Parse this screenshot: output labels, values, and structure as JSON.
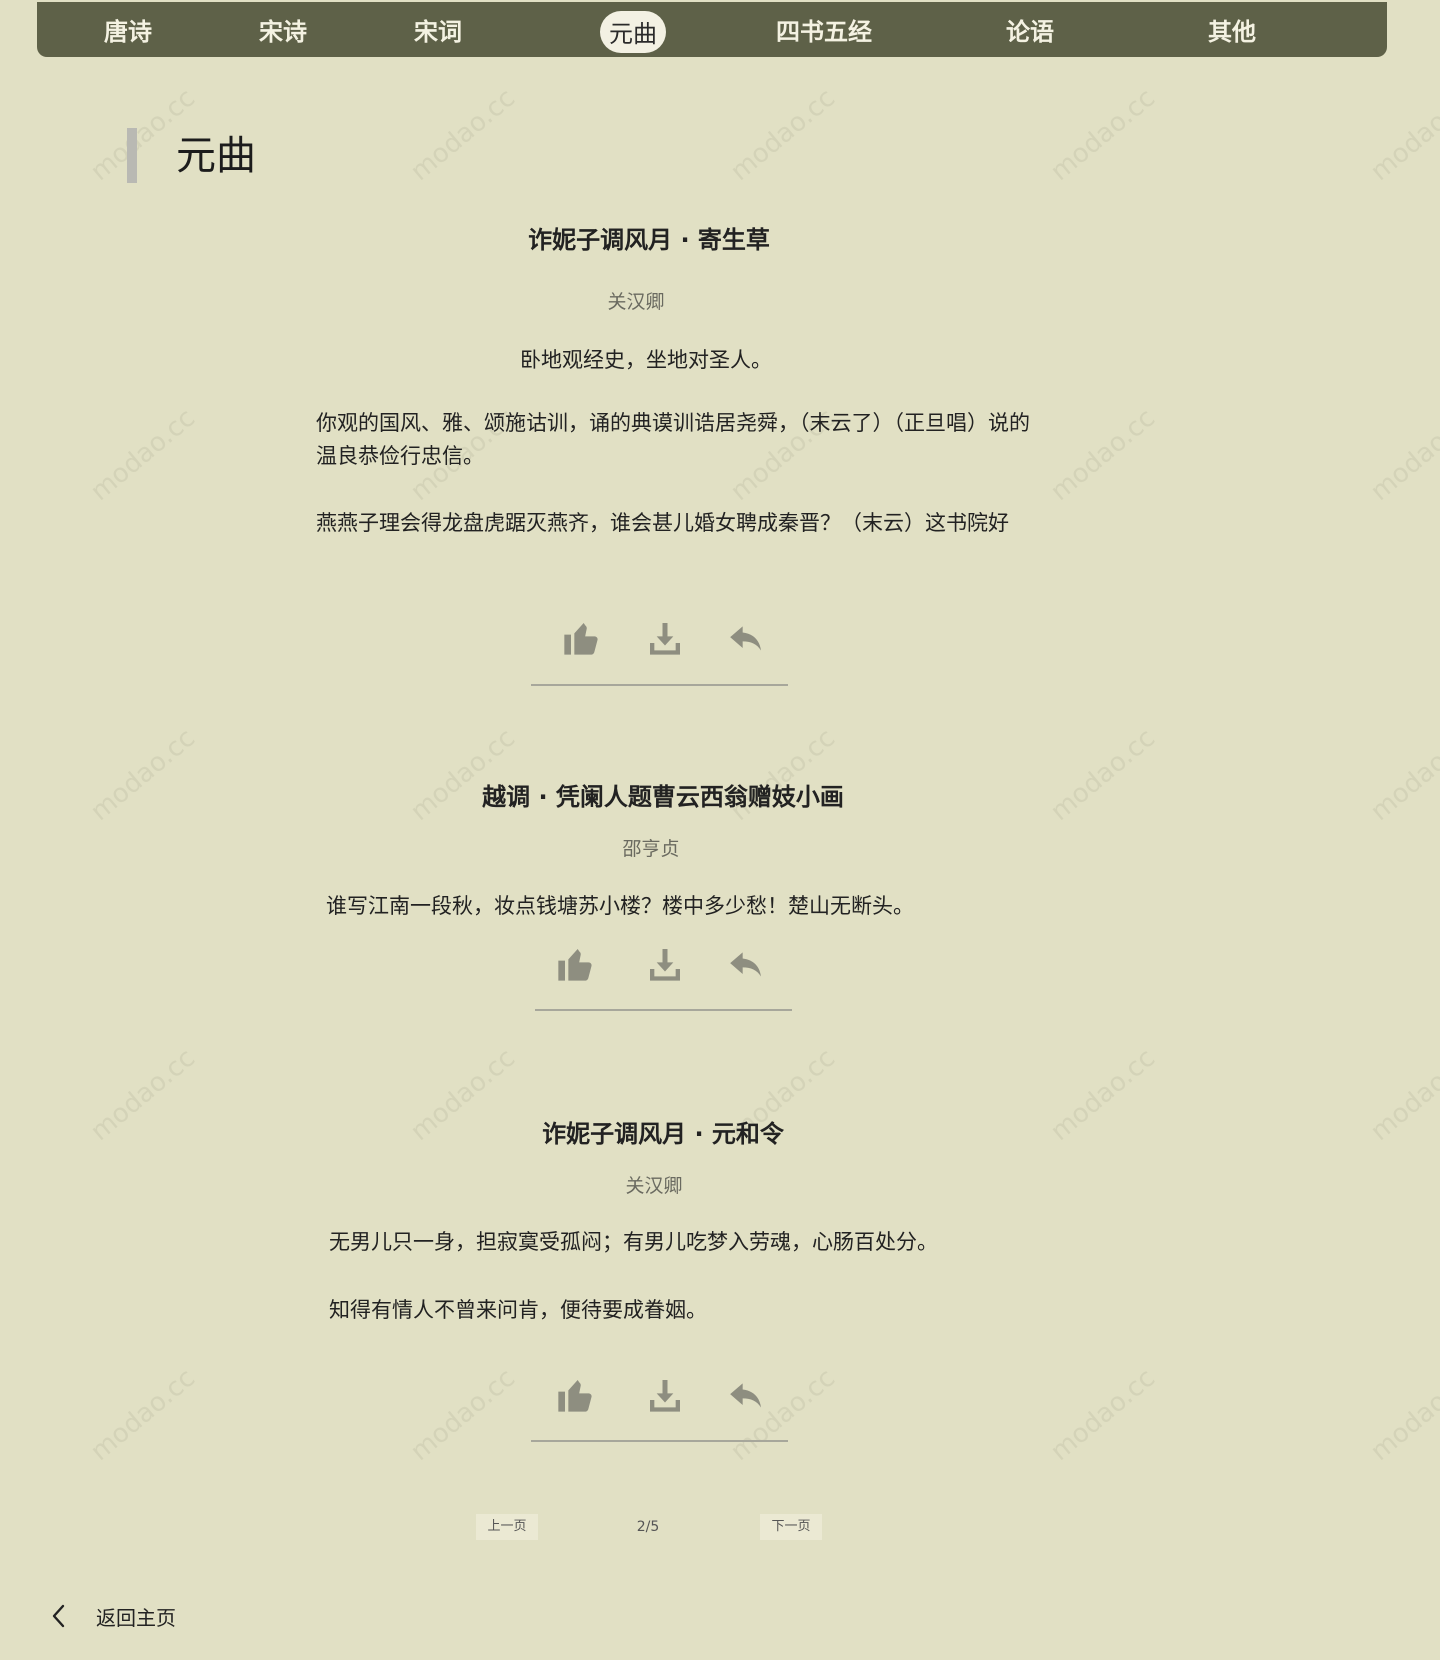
{
  "nav": {
    "items": [
      {
        "label": "唐诗",
        "active": false
      },
      {
        "label": "宋诗",
        "active": false
      },
      {
        "label": "宋词",
        "active": false
      },
      {
        "label": "元曲",
        "active": true
      },
      {
        "label": "四书五经",
        "active": false
      },
      {
        "label": "论语",
        "active": false
      },
      {
        "label": "其他",
        "active": false
      }
    ]
  },
  "watermark": "modao.cc",
  "section": {
    "title": "元曲"
  },
  "poems": [
    {
      "title": "诈妮子调风月 · 寄生草",
      "author": "关汉卿",
      "lines": [
        "卧地观经史，坐地对圣人。",
        "你观的国风、雅、颂施诂训，诵的典谟训诰居尧舜，（末云了）（正旦唱）说的温良恭俭行忠信。",
        "燕燕子理会得龙盘虎踞灭燕齐，谁会甚儿婚女聘成秦晋？（末云）这书院好"
      ]
    },
    {
      "title": "越调 · 凭阑人题曹云西翁赠妓小画",
      "author": "邵亨贞",
      "lines": [
        "谁写江南一段秋，妆点钱塘苏小楼？楼中多少愁！楚山无断头。"
      ]
    },
    {
      "title": "诈妮子调风月 · 元和令",
      "author": "关汉卿",
      "lines": [
        "无男儿只一身，担寂寞受孤闷；有男儿吃梦入劳魂，心肠百处分。",
        "知得有情人不曾来问肯，便待要成眷姻。"
      ]
    }
  ],
  "actions": {
    "icons": [
      "thumbs-up-icon",
      "download-icon",
      "reply-icon"
    ]
  },
  "pagination": {
    "prev_label": "上一页",
    "indicator": "2/5",
    "next_label": "下一页"
  },
  "back": {
    "label": "返回主页",
    "icon": "chevron-left-icon"
  },
  "colors": {
    "background": "#e1e0c4",
    "nav_bar": "#5e6148",
    "icon": "#8e8e80"
  }
}
